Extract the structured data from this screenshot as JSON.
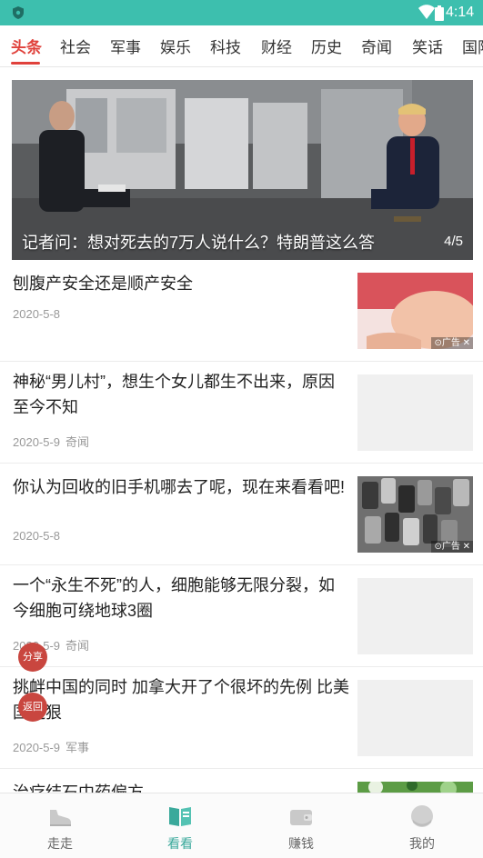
{
  "status_bar": {
    "time": "4:14"
  },
  "tabs": [
    {
      "label": "头条",
      "active": true
    },
    {
      "label": "社会"
    },
    {
      "label": "军事"
    },
    {
      "label": "娱乐"
    },
    {
      "label": "科技"
    },
    {
      "label": "财经"
    },
    {
      "label": "历史"
    },
    {
      "label": "奇闻"
    },
    {
      "label": "笑话"
    },
    {
      "label": "国际"
    }
  ],
  "banner": {
    "title": "记者问：想对死去的7万人说什么？特朗普这么答",
    "counter": "4/5"
  },
  "articles": [
    {
      "title": "刨腹产安全还是顺产安全",
      "date": "2020-5-8",
      "tag": "",
      "ad": true,
      "ad_label": "⊙广告 ✕"
    },
    {
      "title": "神秘“男儿村”，想生个女儿都生不出来，原因至今不知",
      "date": "2020-5-9",
      "tag": "奇闻",
      "ad": false
    },
    {
      "title": "你认为回收的旧手机哪去了呢，现在来看看吧!",
      "date": "2020-5-8",
      "tag": "",
      "ad": true,
      "ad_label": "⊙广告 ✕"
    },
    {
      "title": "一个“永生不死”的人，细胞能够无限分裂，如今细胞可绕地球3圈",
      "date": "2020-5-9",
      "tag": "奇闻",
      "ad": false
    },
    {
      "title": "挑衅中国的同时 加拿大开了个很坏的先例 比美国还狠",
      "date": "2020-5-9",
      "tag": "军事",
      "ad": false
    },
    {
      "title": "治疗结石中药偏方",
      "date": "",
      "tag": "",
      "ad": true
    }
  ],
  "floating": {
    "share": "分享",
    "back": "返回"
  },
  "bottom_nav": [
    {
      "label": "走走",
      "icon": "shoe-icon"
    },
    {
      "label": "看看",
      "icon": "book-icon",
      "active": true
    },
    {
      "label": "赚钱",
      "icon": "wallet-icon"
    },
    {
      "label": "我的",
      "icon": "profile-icon"
    }
  ],
  "colors": {
    "accent_teal": "#3dbfae",
    "tab_active_red": "#e0413b",
    "nav_active": "#3aa99b",
    "float_button": "#c9463f"
  }
}
